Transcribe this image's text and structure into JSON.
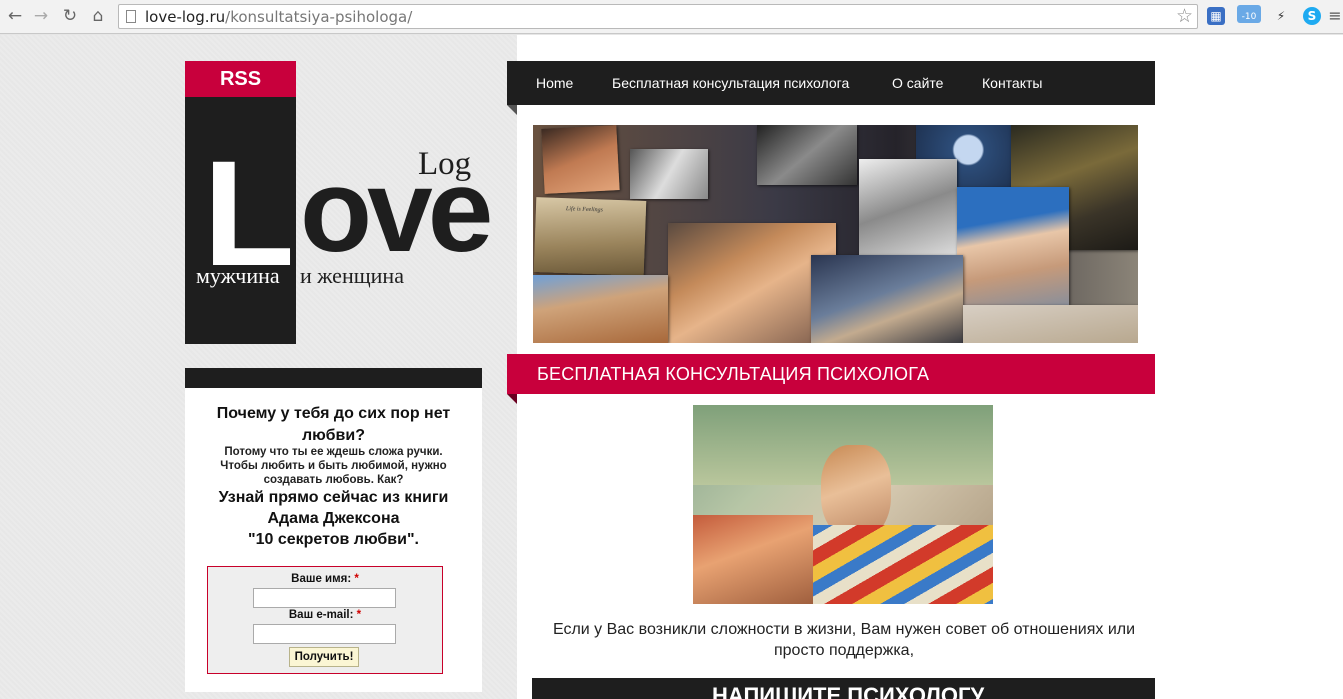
{
  "browser": {
    "url_domain": "love-log.ru",
    "url_path": "/konsultatsiya-psihologa/",
    "weather_badge": "-10"
  },
  "logo": {
    "rss": "RSS",
    "word_l": "L",
    "word_ove": "ove",
    "word_log": "Log",
    "sub_left": "мужчина",
    "sub_right": "и женщина"
  },
  "nav": {
    "items": [
      "Home",
      "Бесплатная консультация психолога",
      "О сайте",
      "Контакты"
    ]
  },
  "sidebar": {
    "title": "Почему у тебя до сих пор нет любви?",
    "small_text": "Потому что ты ее ждешь сложа ручки. Чтобы любить и быть любимой, нужно создавать любовь. Как?",
    "book_line1": "Узнай прямо сейчас из книги",
    "book_line2": "Адама Джексона",
    "book_line3": "\"10 секретов любви\".",
    "form": {
      "name_label": "Ваше имя:",
      "email_label": "Ваш e-mail:",
      "required_mark": "*",
      "name_value": "",
      "email_value": "",
      "submit_label": "Получить!"
    }
  },
  "main": {
    "section_title": "БЕСПЛАТНАЯ КОНСУЛЬТАЦИЯ ПСИХОЛОГА",
    "collage_caption": "Life is Feelings",
    "article_text": "Если у Вас возникли сложности в жизни, Вам нужен совет об отношениях или просто поддержка,",
    "bottom_heading": "НАПИШИТЕ ПСИХОЛОГУ"
  },
  "colors": {
    "accent": "#c8003c",
    "dark": "#1e1e1e"
  },
  "icons": [
    "back-icon",
    "forward-icon",
    "reload-icon",
    "home-icon",
    "page-icon",
    "bookmark-star-icon",
    "keyboard-extension-icon",
    "weather-extension-icon",
    "lightning-extension-icon",
    "skype-extension-icon",
    "menu-icon"
  ]
}
